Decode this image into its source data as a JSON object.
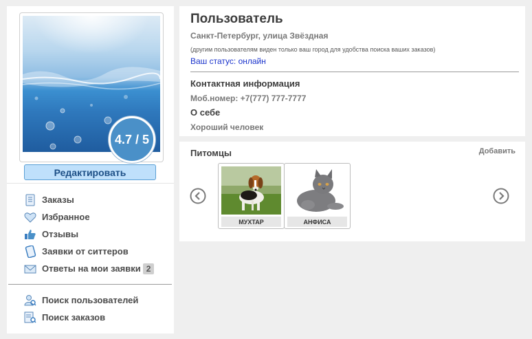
{
  "profile": {
    "rating": "4.7 / 5",
    "edit_label": "Редактировать",
    "name": "Пользователь",
    "address": "Санкт-Петербург, улица Звёздная",
    "visibility_note": "(другим пользователям виден только ваш город для удобства поиска ваших заказов)",
    "status": "Ваш статус: онлайн",
    "contact_heading": "Контактная информация",
    "phone": "Моб.номер: +7(777) 777-7777",
    "about_heading": "О себе",
    "about_text": "Хороший человек"
  },
  "menu": {
    "items": [
      {
        "label": "Заказы",
        "icon": "document-icon"
      },
      {
        "label": "Избранное",
        "icon": "heart-icon"
      },
      {
        "label": "Отзывы",
        "icon": "thumbs-up-icon"
      },
      {
        "label": "Заявки от ситтеров",
        "icon": "tablet-icon"
      },
      {
        "label": "Ответы на мои заявки",
        "icon": "envelope-icon",
        "badge": "2"
      }
    ],
    "secondary": [
      {
        "label": "Поиск пользователей",
        "icon": "users-search-icon"
      },
      {
        "label": "Поиск заказов",
        "icon": "orders-search-icon"
      }
    ]
  },
  "pets": {
    "title": "Питомцы",
    "add_label": "Добавить",
    "items": [
      {
        "name": "МУХТАР",
        "kind": "dog"
      },
      {
        "name": "АНФИСА",
        "kind": "cat"
      }
    ]
  },
  "colors": {
    "accent": "#4a90c8",
    "status_link": "#1a33cc",
    "edit_button_bg": "#bfe0fb"
  }
}
